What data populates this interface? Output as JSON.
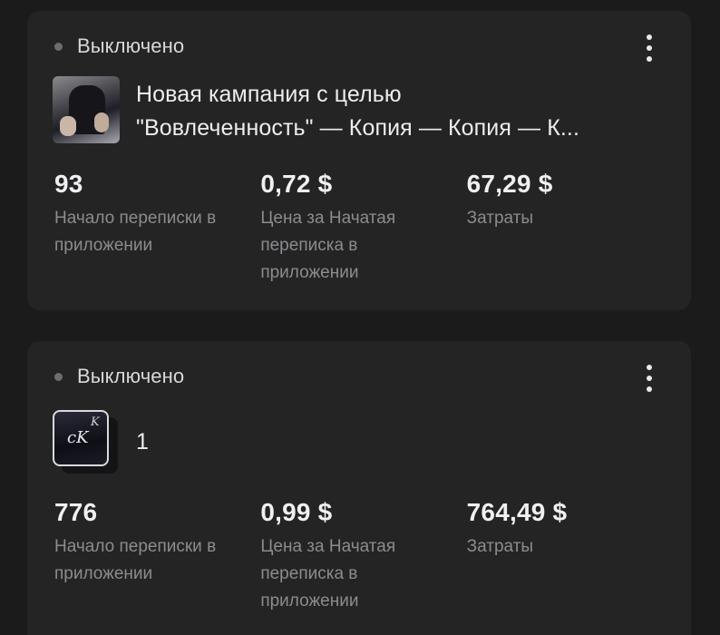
{
  "campaigns": [
    {
      "status": "Выключено",
      "title_line1": "Новая кампания с целью",
      "title_line2": "\"Вовлеченность\" — Копия — Копия — К...",
      "metrics": [
        {
          "value": "93",
          "label": "Начало переписки в приложении"
        },
        {
          "value": "0,72 $",
          "label": "Цена за Начатая переписка в приложении"
        },
        {
          "value": "67,29 $",
          "label": "Затраты"
        }
      ]
    },
    {
      "status": "Выключено",
      "title_line1": "1",
      "title_line2": "",
      "metrics": [
        {
          "value": "776",
          "label": "Начало переписки в приложении"
        },
        {
          "value": "0,99 $",
          "label": "Цена за Начатая переписка в приложении"
        },
        {
          "value": "764,49 $",
          "label": "Затраты"
        }
      ]
    }
  ]
}
